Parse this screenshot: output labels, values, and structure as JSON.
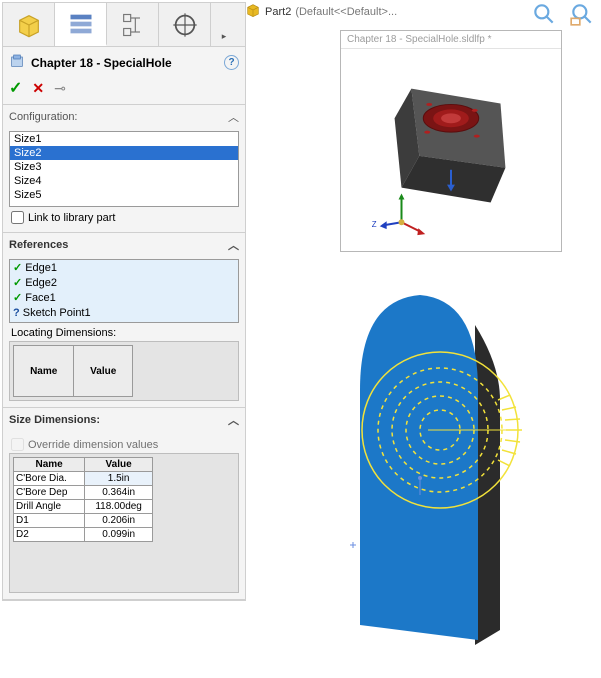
{
  "breadcrumb": {
    "part_label": "Part2",
    "config_label": "(Default<<Default>..."
  },
  "panel": {
    "title": "Chapter 18 - SpecialHole",
    "configuration": {
      "label": "Configuration:",
      "items": [
        "Size1",
        "Size2",
        "Size3",
        "Size4",
        "Size5"
      ],
      "selected_index": 1,
      "link_label": "Link to library part"
    },
    "references": {
      "label": "References",
      "items": [
        {
          "status": "ok",
          "text": "Edge1"
        },
        {
          "status": "ok",
          "text": "Edge2"
        },
        {
          "status": "ok",
          "text": "Face1"
        },
        {
          "status": "q",
          "text": "Sketch Point1"
        }
      ],
      "locating_label": "Locating Dimensions:",
      "columns": [
        "Name",
        "Value"
      ]
    },
    "size_dimensions": {
      "label": "Size Dimensions:",
      "override_label": "Override dimension values",
      "columns": [
        "Name",
        "Value"
      ],
      "rows": [
        {
          "name": "C'Bore Dia.",
          "value": "1.5in",
          "hl": true
        },
        {
          "name": "C'Bore Dep",
          "value": "0.364in"
        },
        {
          "name": "Drill Angle",
          "value": "118.00deg"
        },
        {
          "name": "D1",
          "value": "0.206in"
        },
        {
          "name": "D2",
          "value": "0.099in"
        }
      ]
    }
  },
  "preview": {
    "title": "Chapter 18 - SpecialHole.sldlfp *"
  }
}
